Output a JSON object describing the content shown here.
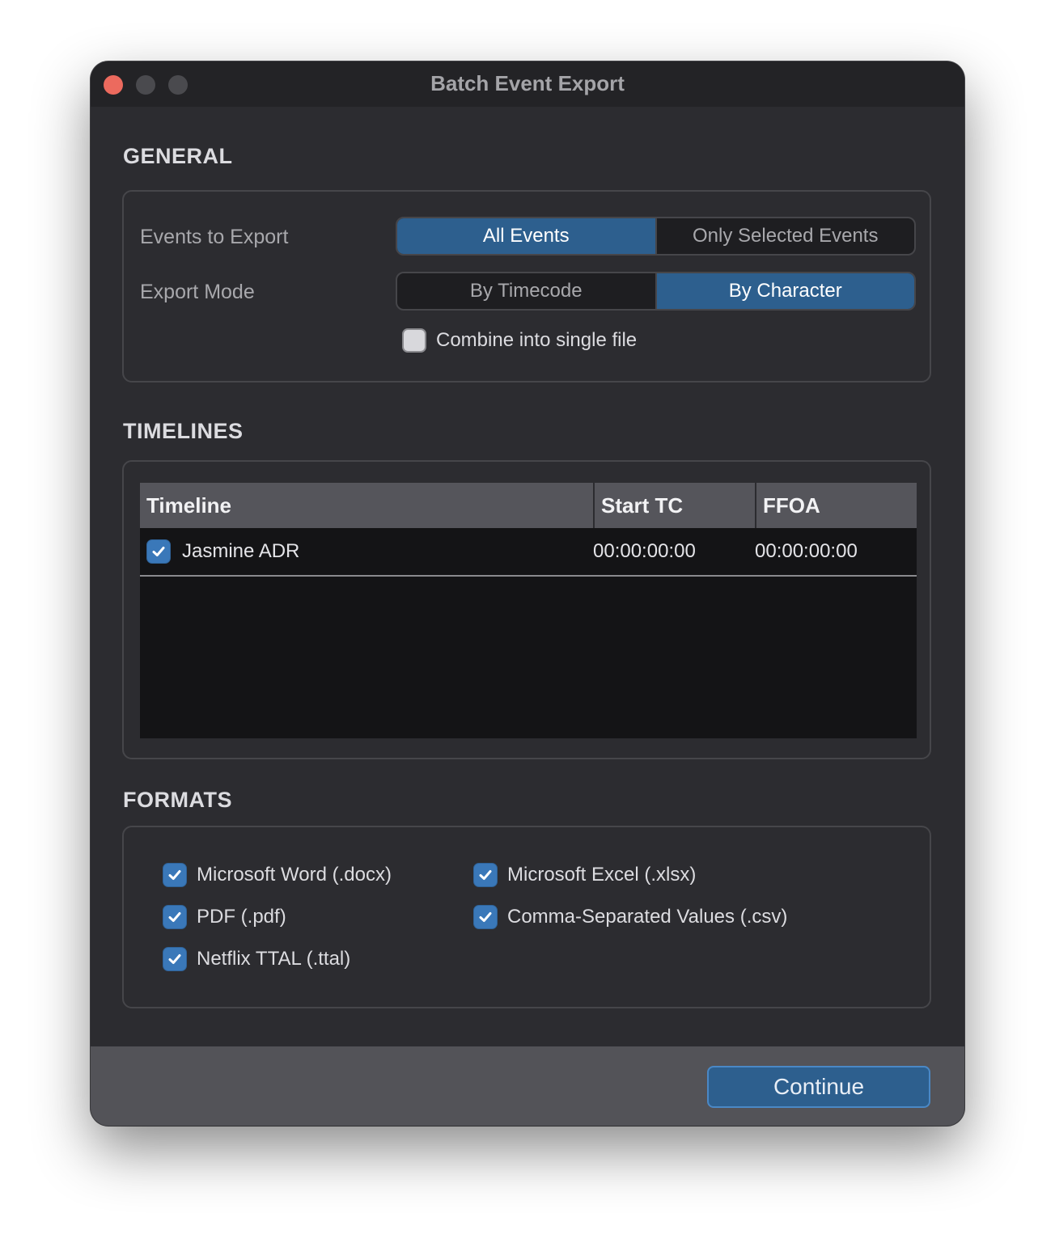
{
  "window": {
    "title": "Batch Event Export",
    "traffic_lights": [
      "close",
      "minimize",
      "zoom"
    ]
  },
  "general": {
    "section_title": "GENERAL",
    "events_to_export": {
      "label": "Events to Export",
      "options": [
        "All Events",
        "Only Selected Events"
      ],
      "selected": "All Events"
    },
    "export_mode": {
      "label": "Export Mode",
      "options": [
        "By Timecode",
        "By Character"
      ],
      "selected": "By Character"
    },
    "combine": {
      "label": "Combine into single file",
      "checked": false
    }
  },
  "timelines": {
    "section_title": "TIMELINES",
    "columns": [
      "Timeline",
      "Start TC",
      "FFOA"
    ],
    "rows": [
      {
        "checked": true,
        "name": "Jasmine ADR",
        "start_tc": "00:00:00:00",
        "ffoa": "00:00:00:00"
      }
    ]
  },
  "formats": {
    "section_title": "FORMATS",
    "items": [
      {
        "label": "Microsoft Word (.docx)",
        "checked": true
      },
      {
        "label": "Microsoft Excel (.xlsx)",
        "checked": true
      },
      {
        "label": "PDF (.pdf)",
        "checked": true
      },
      {
        "label": "Comma-Separated Values (.csv)",
        "checked": true
      },
      {
        "label": "Netflix TTAL (.ttal)",
        "checked": true
      }
    ]
  },
  "footer": {
    "continue_label": "Continue"
  },
  "colors": {
    "accent": "#2d5f8e",
    "checkbox": "#3a78b9",
    "window_bg": "#2c2c30"
  }
}
